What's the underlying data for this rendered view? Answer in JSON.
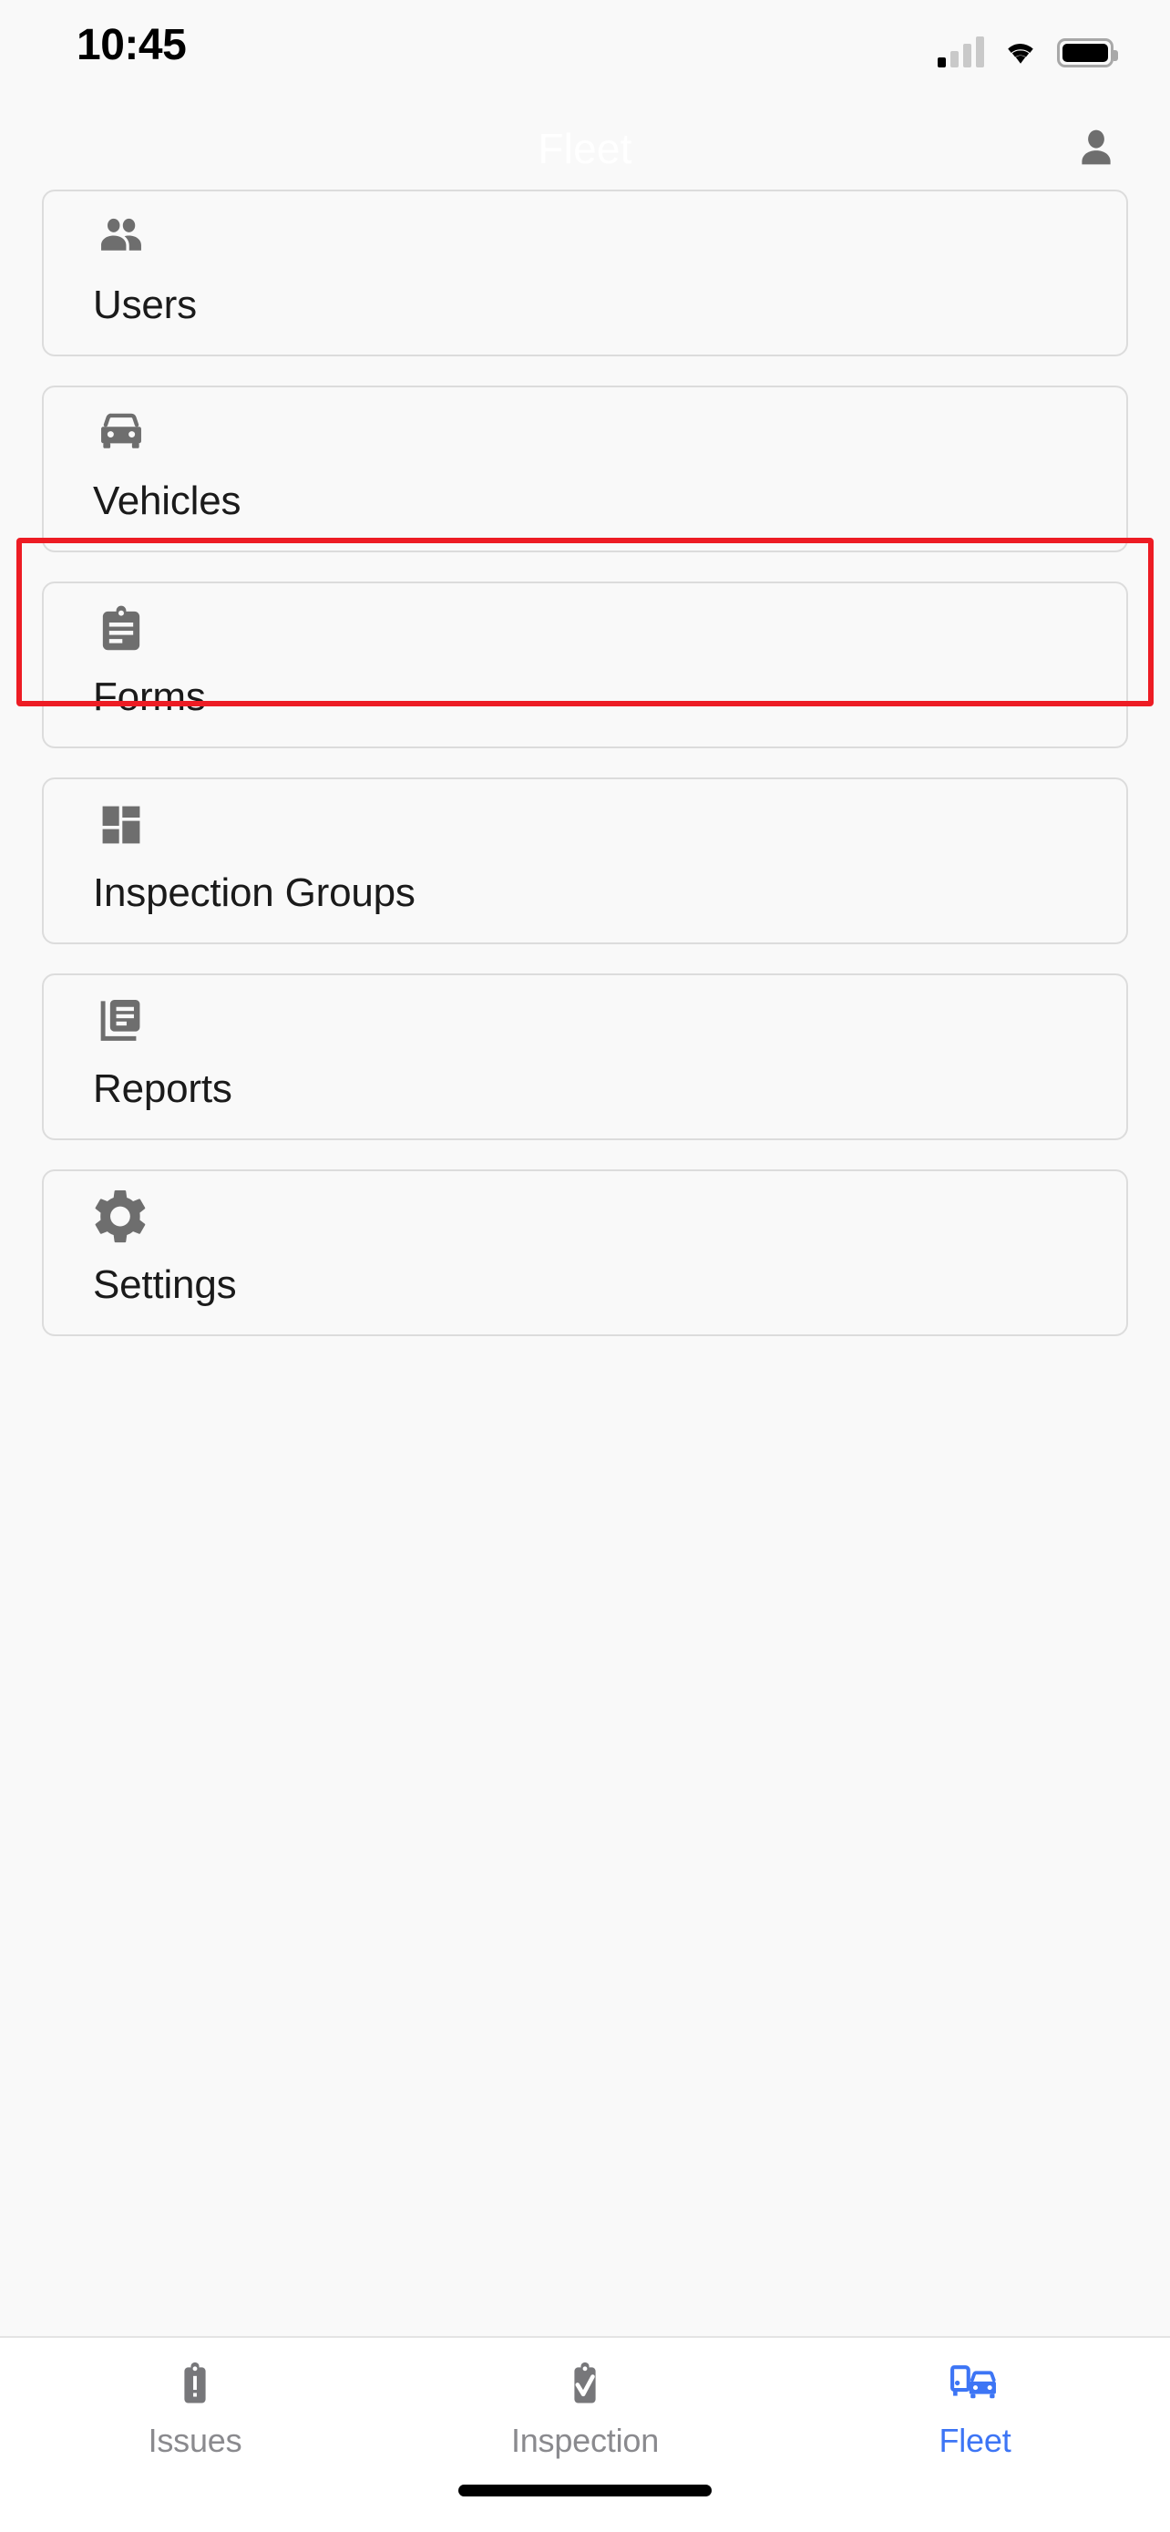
{
  "status_bar": {
    "time": "10:45",
    "cellular_icon": "cellular-signal-icon",
    "wifi_icon": "wifi-icon",
    "battery_icon": "battery-icon"
  },
  "header": {
    "title": "Fleet",
    "title_color": "#FFFFFF",
    "account_icon": "account-person-icon"
  },
  "menu": {
    "items": [
      {
        "label": "Users",
        "icon": "people-group-icon"
      },
      {
        "label": "Vehicles",
        "icon": "car-front-icon"
      },
      {
        "label": "Forms",
        "icon": "clipboard-lines-icon"
      },
      {
        "label": "Inspection Groups",
        "icon": "dashboard-grid-icon"
      },
      {
        "label": "Reports",
        "icon": "documents-stack-icon"
      },
      {
        "label": "Settings",
        "icon": "gear-icon"
      }
    ]
  },
  "annotation": {
    "target": "Vehicles",
    "color": "#ED1C24"
  },
  "tabbar": {
    "active": "Fleet",
    "active_color": "#3D75F5",
    "inactive_color": "#8A8A8E",
    "tabs": [
      {
        "label": "Issues",
        "icon": "clipboard-alert-icon"
      },
      {
        "label": "Inspection",
        "icon": "clipboard-check-icon"
      },
      {
        "label": "Fleet",
        "icon": "vehicles-blue-icon"
      }
    ]
  },
  "home_indicator": "home-indicator-bar"
}
